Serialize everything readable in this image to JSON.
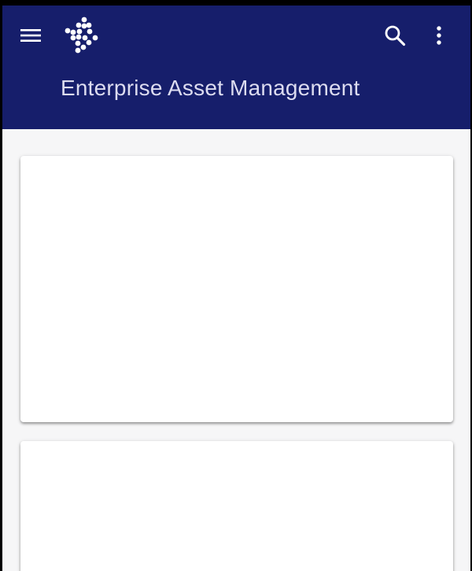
{
  "header": {
    "title": "Enterprise Asset Management",
    "background_color": "#161e6b",
    "title_color": "#dcdcf0",
    "icons": {
      "menu": "hamburger-menu-icon",
      "logo": "dot-diamond-logo",
      "search": "search-icon",
      "more": "more-vertical-icon"
    }
  },
  "content": {
    "background_color": "#f6f6f7",
    "cards": [
      {
        "state": "empty"
      },
      {
        "state": "empty"
      }
    ]
  }
}
